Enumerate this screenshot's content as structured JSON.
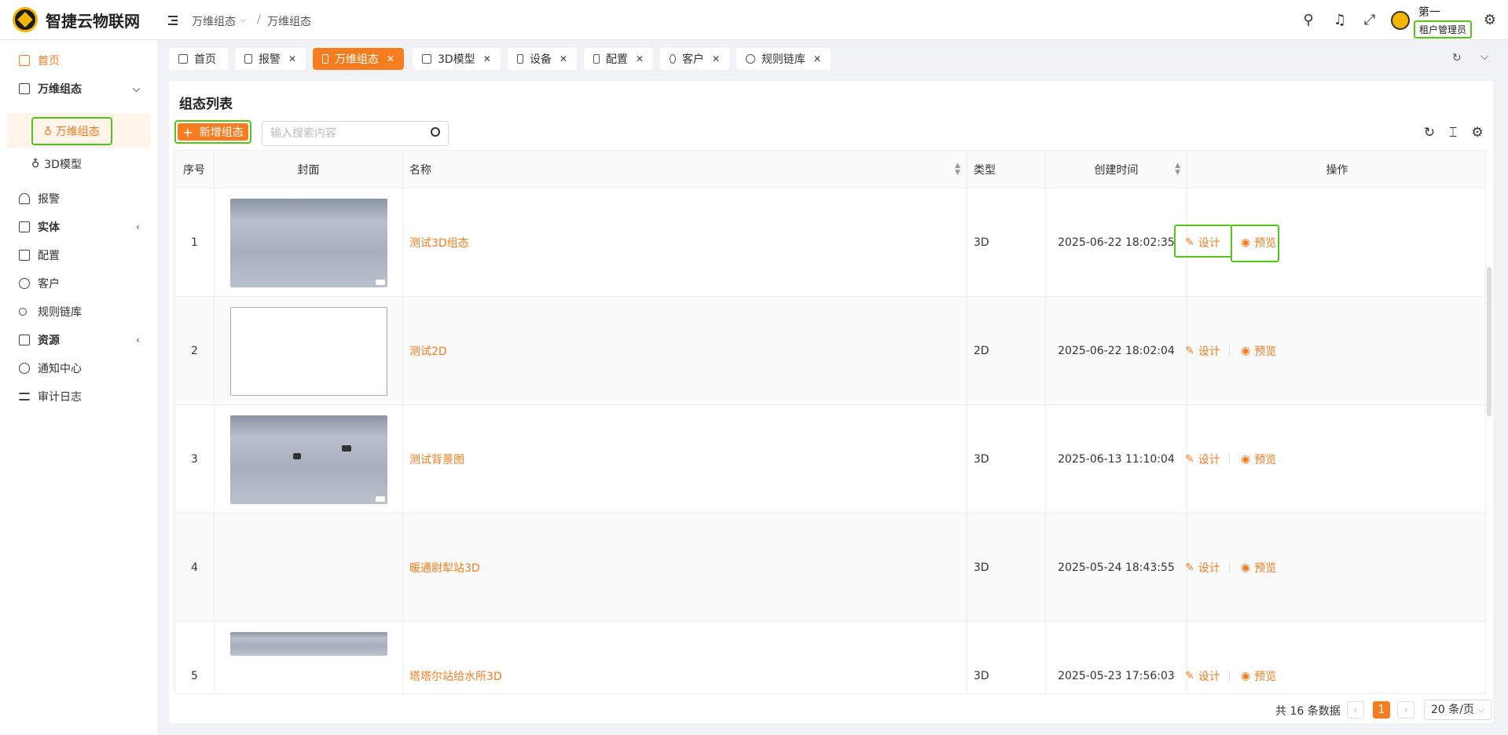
{
  "app": {
    "title": "智捷云物联网"
  },
  "breadcrumb": [
    "万维组态",
    "/",
    "万维组态"
  ],
  "user": {
    "name": "第一",
    "role": "租户管理员"
  },
  "sidebar": {
    "home": "首页",
    "group_configuration": "万维组态",
    "sub_configuration": "万维组态",
    "sub_3d": "3D模型",
    "alarm": "报警",
    "entity": "实体",
    "config": "配置",
    "customer": "客户",
    "rule_chain": "规则链库",
    "resources": "资源",
    "notifications": "通知中心",
    "audit_log": "审计日志"
  },
  "tabs": [
    {
      "label": "首页",
      "closable": false
    },
    {
      "label": "报警",
      "closable": true
    },
    {
      "label": "万维组态",
      "closable": true,
      "active": true
    },
    {
      "label": "3D模型",
      "closable": true
    },
    {
      "label": "设备",
      "closable": true
    },
    {
      "label": "配置",
      "closable": true
    },
    {
      "label": "客户",
      "closable": true
    },
    {
      "label": "规则链库",
      "closable": true
    }
  ],
  "panel": {
    "title": "组态列表",
    "add_button": "新增组态",
    "search_placeholder": "输入搜索内容"
  },
  "table": {
    "headers": {
      "index": "序号",
      "cover": "封面",
      "name": "名称",
      "type": "类型",
      "created": "创建时间",
      "actions": "操作"
    },
    "rows": [
      {
        "index": "1",
        "name": "测试3D组态",
        "type": "3D",
        "created": "2025-06-22 18:02:35",
        "design": "设计",
        "preview": "预览"
      },
      {
        "index": "2",
        "name": "测试2D",
        "type": "2D",
        "created": "2025-06-22 18:02:04",
        "design": "设计",
        "preview": "预览"
      },
      {
        "index": "3",
        "name": "测试背景图",
        "type": "3D",
        "created": "2025-06-13 11:10:04",
        "design": "设计",
        "preview": "预览"
      },
      {
        "index": "4",
        "name": "暖通尉犁站3D",
        "type": "3D",
        "created": "2025-05-24 18:43:55",
        "design": "设计",
        "preview": "预览"
      },
      {
        "index": "5",
        "name": "塔塔尔站给水所3D",
        "type": "3D",
        "created": "2025-05-23 17:56:03",
        "design": "设计",
        "preview": "预览"
      }
    ]
  },
  "pager": {
    "total": "共 16 条数据",
    "current": "1",
    "page_size": "20 条/页"
  },
  "colors": {
    "accent": "#f57c1f",
    "highlight": "#52c41a"
  }
}
